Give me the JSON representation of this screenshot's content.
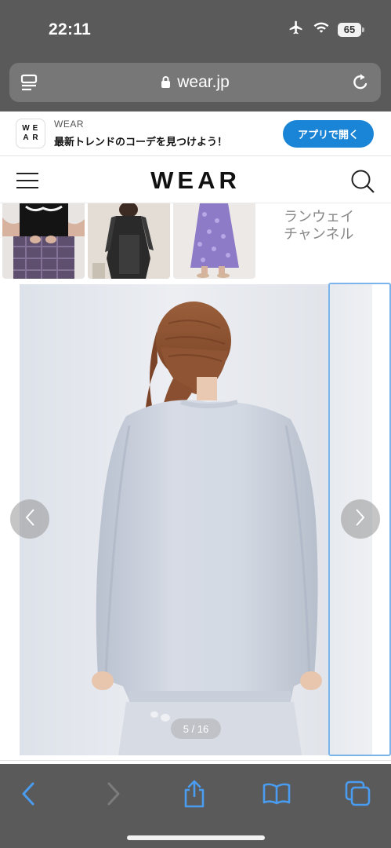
{
  "status_bar": {
    "time": "22:11",
    "battery_level": "65",
    "icons": [
      "airplane-icon",
      "wifi-icon",
      "battery-icon"
    ]
  },
  "browser": {
    "url": "wear.jp",
    "icons": [
      "reader-icon",
      "lock-icon",
      "reload-icon"
    ],
    "toolbar_icons": [
      "back-icon",
      "forward-icon",
      "share-icon",
      "bookmarks-icon",
      "tabs-icon"
    ]
  },
  "app_banner": {
    "icon_letters": [
      "W",
      "E",
      "A",
      "R"
    ],
    "app_name": "WEAR",
    "tagline": "最新トレンドのコーデを見つけよう！",
    "open_button": "アプリで開く",
    "accent_color": "#1a84d6"
  },
  "header": {
    "logo": "WEAR",
    "icons": [
      "hamburger-menu-icon",
      "search-icon"
    ]
  },
  "related": {
    "runway_label_line1": "ランウェイ",
    "runway_label_line2": "チャンネル"
  },
  "gallery": {
    "counter": "5 / 16",
    "current_index": 5,
    "total": 16,
    "icons": [
      "chevron-left-icon",
      "chevron-right-icon"
    ]
  }
}
